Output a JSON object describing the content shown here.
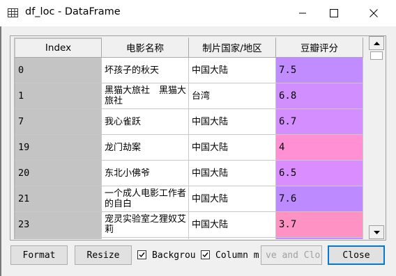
{
  "window": {
    "title": "df_loc - DataFrame",
    "controls": {
      "minimize": "—",
      "maximize": "☐",
      "close": "✕"
    }
  },
  "table": {
    "headers": {
      "index": "Index",
      "col1": "电影名称",
      "col2": "制片国家/地区",
      "col3": "豆瓣评分"
    },
    "rows": [
      {
        "index": "0",
        "name": "坏孩子的秋天",
        "country": "中国大陆",
        "score": "7.5",
        "bg": "#c08cff"
      },
      {
        "index": "1",
        "name": "黑猫大旅社　黑猫大旅社",
        "country": "台湾",
        "score": "6.8",
        "bg": "#d18eff"
      },
      {
        "index": "7",
        "name": "我心雀跃",
        "country": "中国大陆",
        "score": "6.7",
        "bg": "#d58eff"
      },
      {
        "index": "19",
        "name": "龙门劫案",
        "country": "中国大陆",
        "score": "4",
        "bg": "#ff90d3"
      },
      {
        "index": "20",
        "name": "东北小佛爷",
        "country": "中国大陆",
        "score": "6.5",
        "bg": "#d98dff"
      },
      {
        "index": "21",
        "name": "一个成人电影工作者的自白",
        "country": "中国大陆",
        "score": "7.6",
        "bg": "#bd8bff"
      },
      {
        "index": "23",
        "name": "宠灵实验室之狸奴艾莉",
        "country": "中国大陆",
        "score": "3.7",
        "bg": "#ff92c4"
      }
    ]
  },
  "buttons": {
    "format": "Format",
    "resize": "Resize",
    "background": "Backgrou",
    "column": "Column m",
    "save": "ve and Clo",
    "close": "Close"
  }
}
